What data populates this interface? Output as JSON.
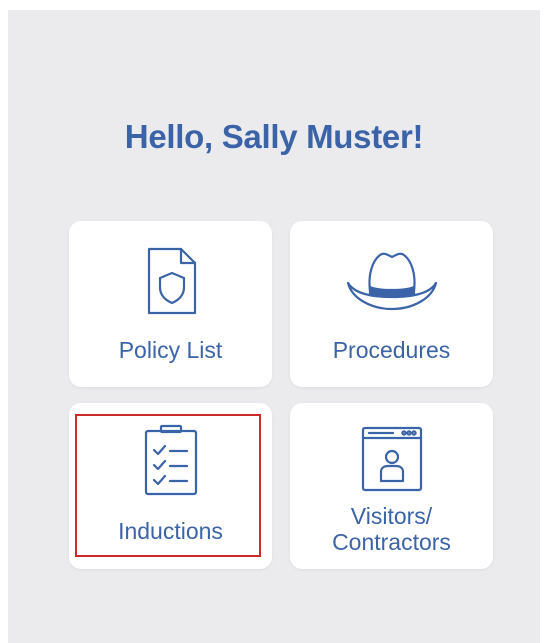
{
  "greeting": "Hello, Sally Muster!",
  "tiles": [
    {
      "label": "Policy List",
      "icon": "policy-shield-document-icon"
    },
    {
      "label": "Procedures",
      "icon": "hard-hat-icon"
    },
    {
      "label": "Inductions",
      "icon": "checklist-clipboard-icon"
    },
    {
      "label_line1": "Visitors/",
      "label_line2": "Contractors",
      "icon": "visitor-badge-window-icon"
    }
  ],
  "colors": {
    "brand": "#3b63a8",
    "background": "#ebebee",
    "tile": "#ffffff",
    "highlight": "#cc2a2a"
  }
}
